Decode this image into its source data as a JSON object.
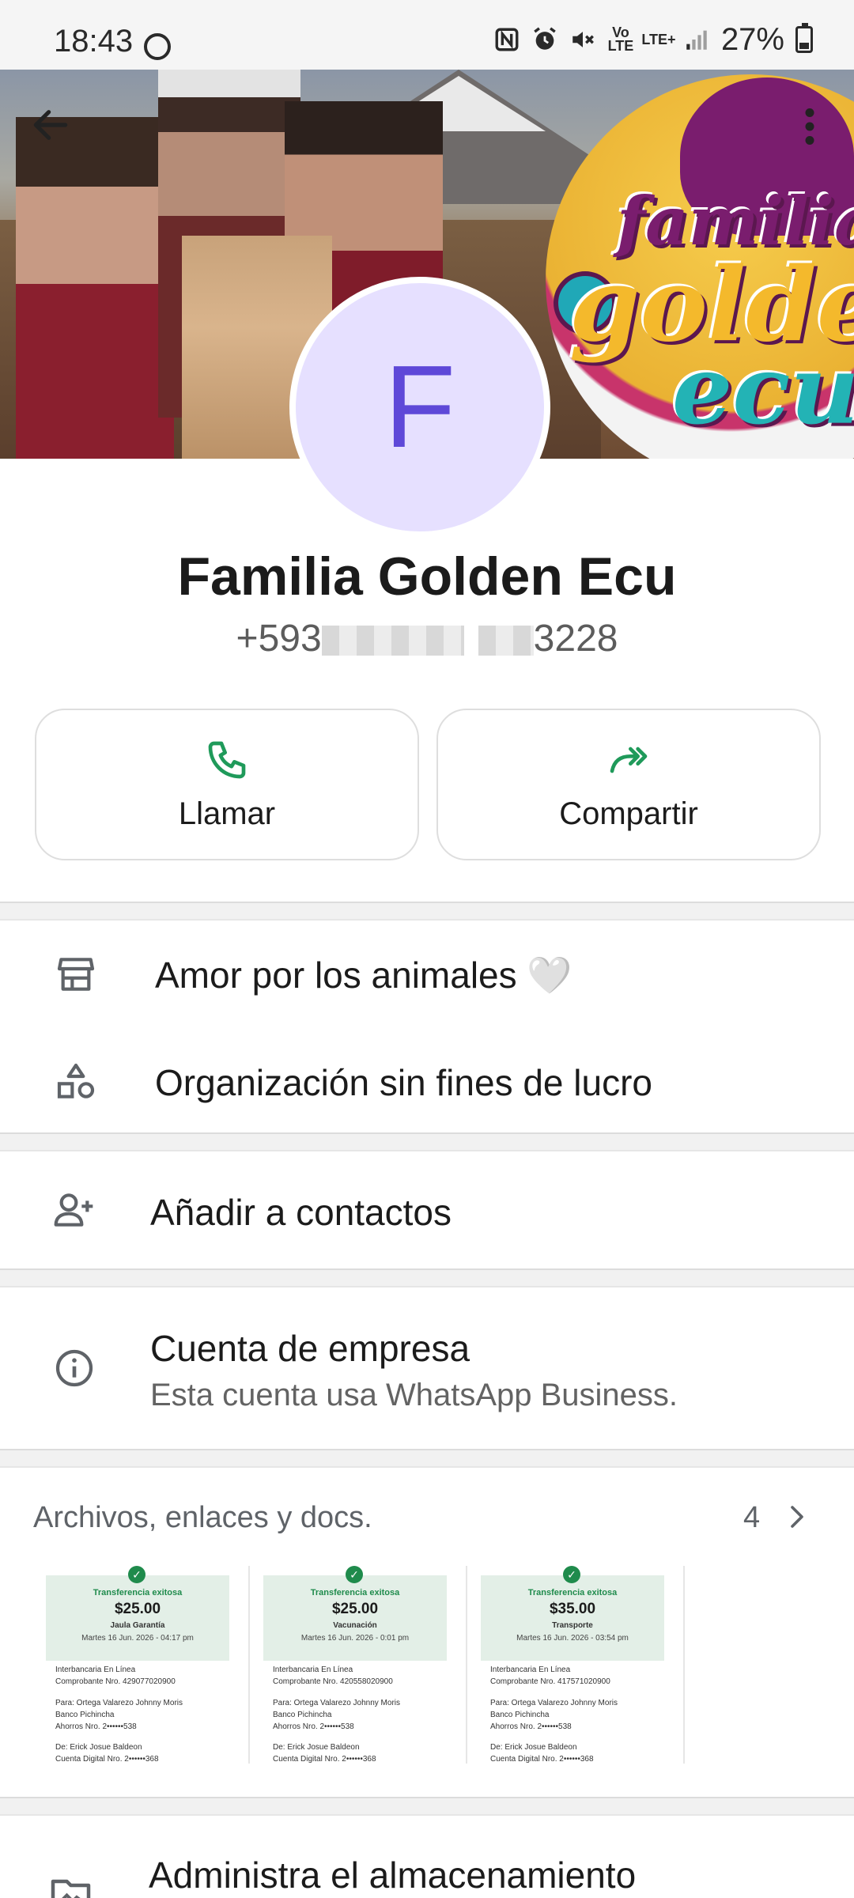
{
  "status_bar": {
    "time": "18:43",
    "volte": "Vo LTE",
    "lte": "LTE+",
    "battery_percent": "27%",
    "battery_level": 0.27,
    "icons": [
      "whatsapp-icon",
      "nfc-icon",
      "alarm-icon",
      "mute-icon",
      "volte-icon",
      "lte-icon",
      "signal-icon",
      "battery-icon"
    ]
  },
  "header": {
    "cover_logo": [
      "familia",
      "golden",
      "ecu"
    ],
    "avatar_letter": "F",
    "avatar_bg": "#e6e0ff",
    "avatar_fg": "#5e48d8"
  },
  "profile": {
    "name": "Familia Golden Ecu",
    "phone_prefix": "+593",
    "phone_suffix": "3228"
  },
  "actions": [
    {
      "label": "Llamar",
      "icon": "phone-icon"
    },
    {
      "label": "Compartir",
      "icon": "share-forward-icon"
    }
  ],
  "accent_color": "#1f9a5a",
  "business_info": [
    {
      "icon": "store-icon",
      "text": "Amor por los animales 🤍"
    },
    {
      "icon": "category-icon",
      "text": "Organización sin fines de lucro"
    }
  ],
  "add_contact": {
    "icon": "person-add-icon",
    "text": "Añadir a contactos"
  },
  "business_account": {
    "icon": "info-icon",
    "title": "Cuenta de empresa",
    "subtitle": "Esta cuenta usa WhatsApp Business."
  },
  "media": {
    "title": "Archivos, enlaces y docs.",
    "count": "4",
    "items": [
      {
        "status": "Transferencia exitosa",
        "amount": "$25.00",
        "concept": "Jaula Garantía",
        "date": "Martes 16 Jun. 2026 - 04:17 pm",
        "line1": "Interbancaria En Línea",
        "line2": "Comprobante Nro. 429077020900",
        "line3": "Para: Ortega Valarezo Johnny Moris",
        "line4": "Banco Pichincha",
        "line5": "Ahorros Nro. 2••••••538",
        "line6": "De: Erick Josue Baldeon",
        "line7": "Cuenta Digital Nro. 2••••••368"
      },
      {
        "status": "Transferencia exitosa",
        "amount": "$25.00",
        "concept": "Vacunación",
        "date": "Martes 16 Jun. 2026 - 0:01 pm",
        "line1": "Interbancaria En Línea",
        "line2": "Comprobante Nro. 420558020900",
        "line3": "Para: Ortega Valarezo Johnny Moris",
        "line4": "Banco Pichincha",
        "line5": "Ahorros Nro. 2••••••538",
        "line6": "De: Erick Josue Baldeon",
        "line7": "Cuenta Digital Nro. 2••••••368"
      },
      {
        "status": "Transferencia exitosa",
        "amount": "$35.00",
        "concept": "Transporte",
        "date": "Martes 16 Jun. 2026 - 03:54 pm",
        "line1": "Interbancaria En Línea",
        "line2": "Comprobante Nro. 417571020900",
        "line3": "Para: Ortega Valarezo Johnny Moris",
        "line4": "Banco Pichincha",
        "line5": "Ahorros Nro. 2••••••538",
        "line6": "De: Erick Josue Baldeon",
        "line7": "Cuenta Digital Nro. 2••••••368"
      }
    ]
  },
  "storage": {
    "icon": "photo-folder-icon",
    "text": "Administra el almacenamiento"
  }
}
